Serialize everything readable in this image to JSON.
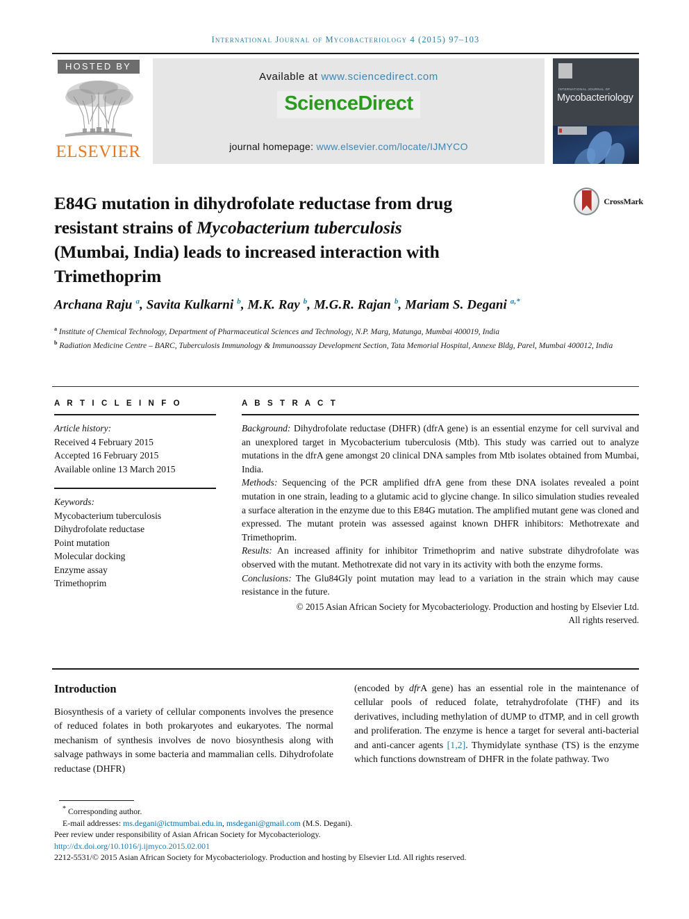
{
  "running_head": "International Journal of Mycobacteriology 4 (2015) 97–103",
  "masthead": {
    "hosted_by": "HOSTED BY",
    "publisher": "ELSEVIER",
    "available_prefix": "Available at ",
    "available_url": "www.sciencedirect.com",
    "sciencedirect_logo": "ScienceDirect",
    "homepage_prefix": "journal homepage: ",
    "homepage_url": "www.elsevier.com/locate/IJMYCO",
    "cover": {
      "kicker": "INTERNATIONAL JOURNAL OF",
      "title": "Mycobacteriology"
    }
  },
  "article": {
    "title_line1": "E84G mutation in dihydrofolate reductase from drug",
    "title_line2_a": "resistant strains of ",
    "title_line2_italic": "Mycobacterium tuberculosis",
    "title_line3": "(Mumbai, India) leads to increased interaction with",
    "title_line4": "Trimethoprim",
    "crossmark_label": "CrossMark",
    "authors": [
      {
        "name": "Archana Raju",
        "sup": "a"
      },
      {
        "name": "Savita Kulkarni",
        "sup": "b"
      },
      {
        "name": "M.K. Ray",
        "sup": "b"
      },
      {
        "name": "M.G.R. Rajan",
        "sup": "b"
      },
      {
        "name": "Mariam S. Degani",
        "sup": "a,*"
      }
    ],
    "affiliations": [
      {
        "marker": "a",
        "text": "Institute of Chemical Technology, Department of Pharmaceutical Sciences and Technology, N.P. Marg, Matunga, Mumbai 400019, India"
      },
      {
        "marker": "b",
        "text": "Radiation Medicine Centre – BARC, Tuberculosis Immunology & Immunoassay Development Section, Tata Memorial Hospital, Annexe Bldg, Parel, Mumbai 400012, India"
      }
    ]
  },
  "article_info": {
    "heading": "A R T I C L E   I N F O",
    "history_label": "Article history:",
    "history": [
      "Received 4 February 2015",
      "Accepted 16 February 2015",
      "Available online 13 March 2015"
    ],
    "keywords_label": "Keywords:",
    "keywords": [
      "Mycobacterium tuberculosis",
      "Dihydrofolate reductase",
      "Point mutation",
      "Molecular docking",
      "Enzyme assay",
      "Trimethoprim"
    ]
  },
  "abstract": {
    "heading": "A B S T R A C T",
    "background_label": "Background:",
    "background_text": " Dihydrofolate reductase (DHFR) (dfrA gene) is an essential enzyme for cell survival and an unexplored target in Mycobacterium tuberculosis (Mtb). This study was carried out to analyze mutations in the dfrA gene amongst 20 clinical DNA samples from Mtb isolates obtained from Mumbai, India.",
    "methods_label": "Methods:",
    "methods_text": " Sequencing of the PCR amplified dfrA gene from these DNA isolates revealed a point mutation in one strain, leading to a glutamic acid to glycine change. In silico simulation studies revealed a surface alteration in the enzyme due to this E84G mutation. The amplified mutant gene was cloned and expressed. The mutant protein was assessed against known DHFR inhibitors: Methotrexate and Trimethoprim.",
    "results_label": "Results:",
    "results_text": " An increased affinity for inhibitor Trimethoprim and native substrate dihydrofolate was observed with the mutant. Methotrexate did not vary in its activity with both the enzyme forms.",
    "conclusions_label": "Conclusions:",
    "conclusions_text": " The Glu84Gly point mutation may lead to a variation in the strain which may cause resistance in the future.",
    "copyright_line1": "© 2015 Asian African Society for Mycobacteriology. Production and hosting by Elsevier Ltd.",
    "copyright_line2": "All rights reserved."
  },
  "body": {
    "intro_heading": "Introduction",
    "left_paragraph": "Biosynthesis of a variety of cellular components involves the presence of reduced folates in both prokaryotes and eukaryotes. The normal mechanism of synthesis involves de novo biosynthesis along with salvage pathways in some bacteria and mammalian cells. Dihydrofolate reductase (DHFR)",
    "right_paragraph_a": "(encoded by ",
    "right_paragraph_italic": "dfr",
    "right_paragraph_b": "A gene) has an essential role in the maintenance of cellular pools of reduced folate, tetrahydrofolate (THF) and its derivatives, including methylation of dUMP to dTMP, and in cell growth and proliferation. The enzyme is hence a target for several anti-bacterial and anti-cancer agents ",
    "right_reference": "[1,2]",
    "right_paragraph_c": ". Thymidylate synthase (TS) is the enzyme which functions downstream of DHFR in the folate pathway. Two"
  },
  "footer": {
    "corresponding": "Corresponding author.",
    "email_label": "E-mail addresses: ",
    "email1": "ms.degani@ictmumbai.edu.in",
    "email_sep": ", ",
    "email2": "msdegani@gmail.com",
    "email_suffix": " (M.S. Degani).",
    "peer_review": "Peer review under responsibility of Asian African Society for Mycobacteriology.",
    "doi": "http://dx.doi.org/10.1016/j.ijmyco.2015.02.001",
    "issn_line": "2212-5531/© 2015 Asian African Society for Mycobacteriology. Production and hosting by Elsevier Ltd. All rights reserved."
  },
  "colors": {
    "link_blue": "#2a7fa8",
    "sciencedirect_green": "#2b9b1f",
    "elsevier_orange": "#e87722",
    "hosted_gray": "#6d6d6d",
    "crossmark_red": "#b03028"
  }
}
